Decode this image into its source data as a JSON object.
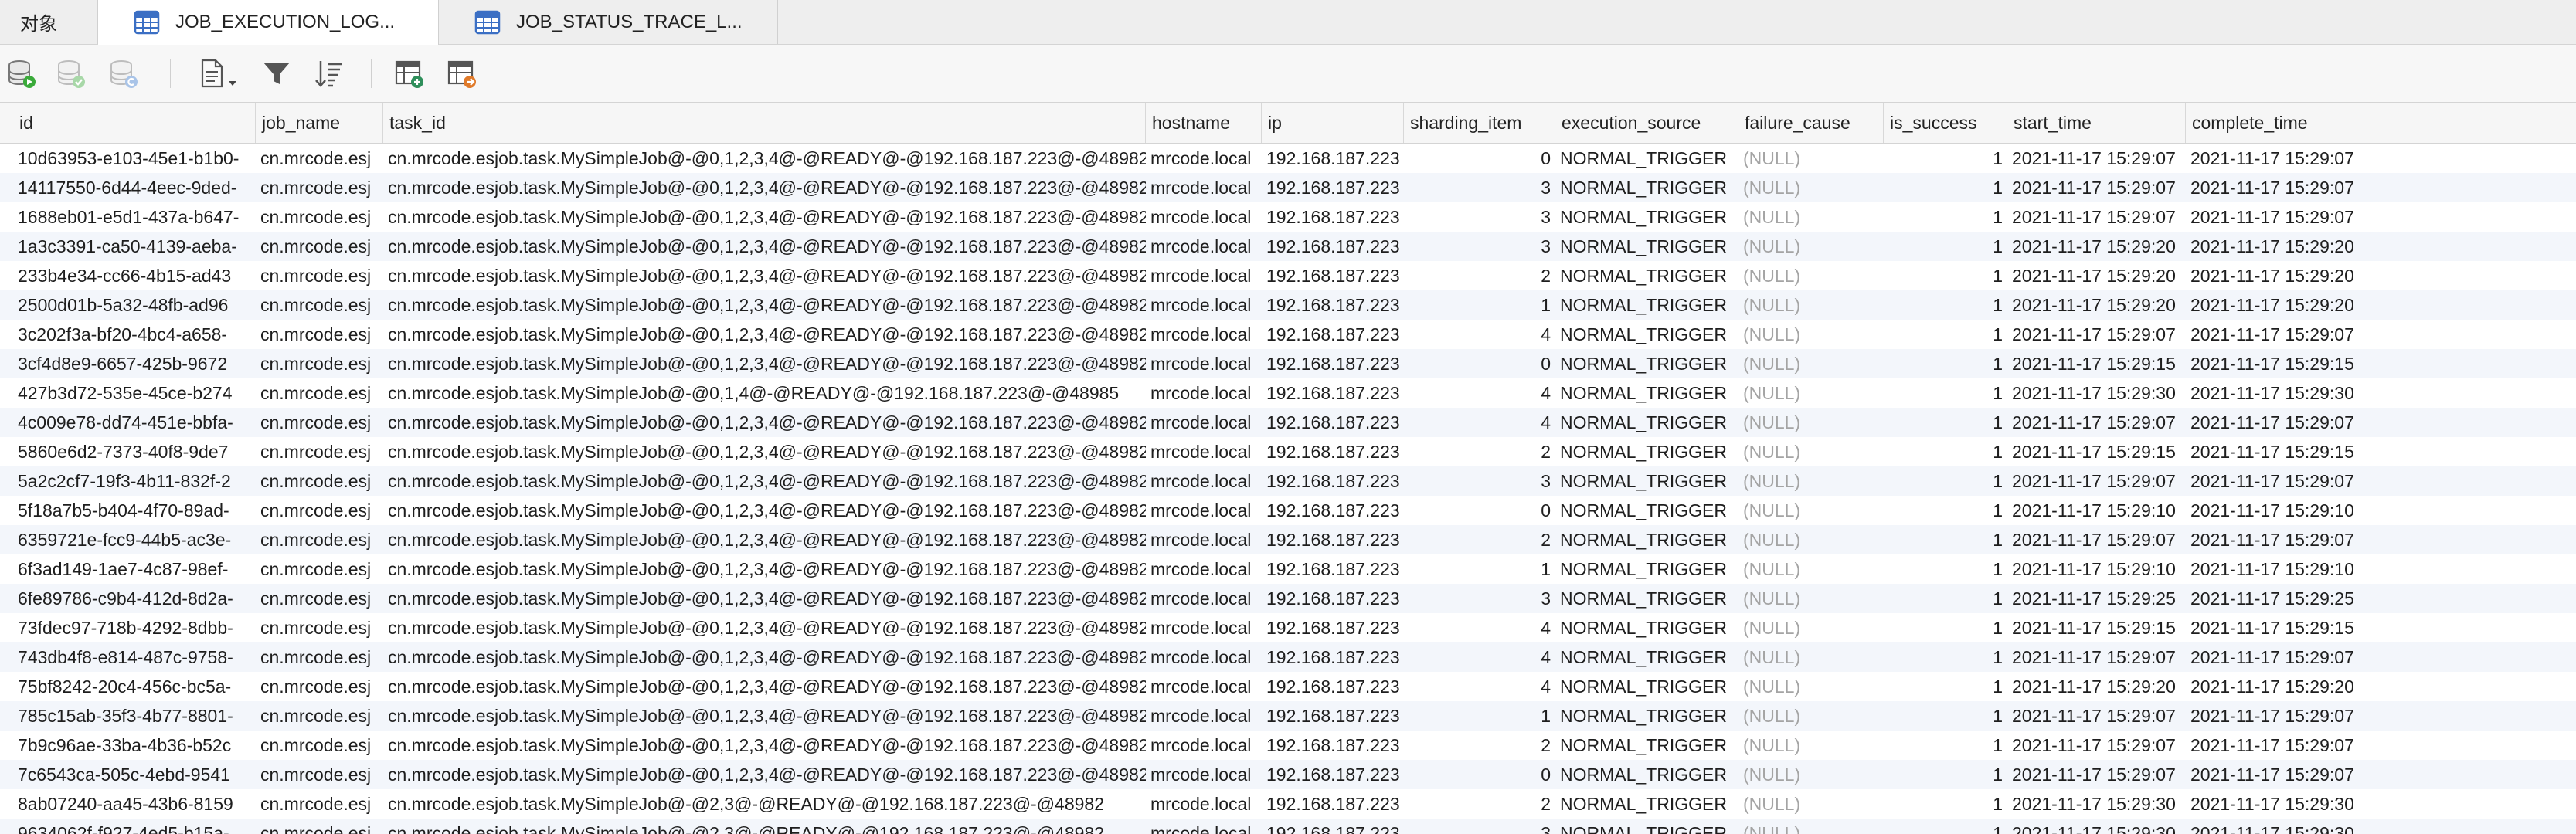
{
  "tabs": {
    "objects": "对象",
    "active": "JOB_EXECUTION_LOG...",
    "second": "JOB_STATUS_TRACE_L..."
  },
  "toolbar": [
    {
      "name": "begin-transaction-icon"
    },
    {
      "name": "commit-icon"
    },
    {
      "name": "rollback-icon"
    },
    {
      "name": "text-view-icon"
    },
    {
      "name": "filter-icon"
    },
    {
      "name": "sort-icon"
    },
    {
      "name": "import-icon"
    },
    {
      "name": "export-icon"
    }
  ],
  "columns": [
    "id",
    "job_name",
    "task_id",
    "hostname",
    "ip",
    "sharding_item",
    "execution_source",
    "failure_cause",
    "is_success",
    "start_time",
    "complete_time"
  ],
  "rows": [
    [
      "10d63953-e103-45e1-b1b0-",
      "cn.mrcode.esj",
      "cn.mrcode.esjob.task.MySimpleJob@-@0,1,2,3,4@-@READY@-@192.168.187.223@-@48982",
      "mrcode.local",
      "192.168.187.223",
      "0",
      "NORMAL_TRIGGER",
      "(NULL)",
      "1",
      "2021-11-17 15:29:07",
      "2021-11-17 15:29:07"
    ],
    [
      "14117550-6d44-4eec-9ded-",
      "cn.mrcode.esj",
      "cn.mrcode.esjob.task.MySimpleJob@-@0,1,2,3,4@-@READY@-@192.168.187.223@-@48982",
      "mrcode.local",
      "192.168.187.223",
      "3",
      "NORMAL_TRIGGER",
      "(NULL)",
      "1",
      "2021-11-17 15:29:07",
      "2021-11-17 15:29:07"
    ],
    [
      "1688eb01-e5d1-437a-b647-",
      "cn.mrcode.esj",
      "cn.mrcode.esjob.task.MySimpleJob@-@0,1,2,3,4@-@READY@-@192.168.187.223@-@48982",
      "mrcode.local",
      "192.168.187.223",
      "3",
      "NORMAL_TRIGGER",
      "(NULL)",
      "1",
      "2021-11-17 15:29:07",
      "2021-11-17 15:29:07"
    ],
    [
      "1a3c3391-ca50-4139-aeba-",
      "cn.mrcode.esj",
      "cn.mrcode.esjob.task.MySimpleJob@-@0,1,2,3,4@-@READY@-@192.168.187.223@-@48982",
      "mrcode.local",
      "192.168.187.223",
      "3",
      "NORMAL_TRIGGER",
      "(NULL)",
      "1",
      "2021-11-17 15:29:20",
      "2021-11-17 15:29:20"
    ],
    [
      "233b4e34-cc66-4b15-ad43",
      "cn.mrcode.esj",
      "cn.mrcode.esjob.task.MySimpleJob@-@0,1,2,3,4@-@READY@-@192.168.187.223@-@48982",
      "mrcode.local",
      "192.168.187.223",
      "2",
      "NORMAL_TRIGGER",
      "(NULL)",
      "1",
      "2021-11-17 15:29:20",
      "2021-11-17 15:29:20"
    ],
    [
      "2500d01b-5a32-48fb-ad96",
      "cn.mrcode.esj",
      "cn.mrcode.esjob.task.MySimpleJob@-@0,1,2,3,4@-@READY@-@192.168.187.223@-@48982",
      "mrcode.local",
      "192.168.187.223",
      "1",
      "NORMAL_TRIGGER",
      "(NULL)",
      "1",
      "2021-11-17 15:29:20",
      "2021-11-17 15:29:20"
    ],
    [
      "3c202f3a-bf20-4bc4-a658-",
      "cn.mrcode.esj",
      "cn.mrcode.esjob.task.MySimpleJob@-@0,1,2,3,4@-@READY@-@192.168.187.223@-@48982",
      "mrcode.local",
      "192.168.187.223",
      "4",
      "NORMAL_TRIGGER",
      "(NULL)",
      "1",
      "2021-11-17 15:29:07",
      "2021-11-17 15:29:07"
    ],
    [
      "3cf4d8e9-6657-425b-9672",
      "cn.mrcode.esj",
      "cn.mrcode.esjob.task.MySimpleJob@-@0,1,2,3,4@-@READY@-@192.168.187.223@-@48982",
      "mrcode.local",
      "192.168.187.223",
      "0",
      "NORMAL_TRIGGER",
      "(NULL)",
      "1",
      "2021-11-17 15:29:15",
      "2021-11-17 15:29:15"
    ],
    [
      "427b3d72-535e-45ce-b274",
      "cn.mrcode.esj",
      "cn.mrcode.esjob.task.MySimpleJob@-@0,1,4@-@READY@-@192.168.187.223@-@48985",
      "mrcode.local",
      "192.168.187.223",
      "4",
      "NORMAL_TRIGGER",
      "(NULL)",
      "1",
      "2021-11-17 15:29:30",
      "2021-11-17 15:29:30"
    ],
    [
      "4c009e78-dd74-451e-bbfa-",
      "cn.mrcode.esj",
      "cn.mrcode.esjob.task.MySimpleJob@-@0,1,2,3,4@-@READY@-@192.168.187.223@-@48982",
      "mrcode.local",
      "192.168.187.223",
      "4",
      "NORMAL_TRIGGER",
      "(NULL)",
      "1",
      "2021-11-17 15:29:07",
      "2021-11-17 15:29:07"
    ],
    [
      "5860e6d2-7373-40f8-9de7",
      "cn.mrcode.esj",
      "cn.mrcode.esjob.task.MySimpleJob@-@0,1,2,3,4@-@READY@-@192.168.187.223@-@48982",
      "mrcode.local",
      "192.168.187.223",
      "2",
      "NORMAL_TRIGGER",
      "(NULL)",
      "1",
      "2021-11-17 15:29:15",
      "2021-11-17 15:29:15"
    ],
    [
      "5a2c2cf7-19f3-4b11-832f-2",
      "cn.mrcode.esj",
      "cn.mrcode.esjob.task.MySimpleJob@-@0,1,2,3,4@-@READY@-@192.168.187.223@-@48982",
      "mrcode.local",
      "192.168.187.223",
      "3",
      "NORMAL_TRIGGER",
      "(NULL)",
      "1",
      "2021-11-17 15:29:07",
      "2021-11-17 15:29:07"
    ],
    [
      "5f18a7b5-b404-4f70-89ad-",
      "cn.mrcode.esj",
      "cn.mrcode.esjob.task.MySimpleJob@-@0,1,2,3,4@-@READY@-@192.168.187.223@-@48982",
      "mrcode.local",
      "192.168.187.223",
      "0",
      "NORMAL_TRIGGER",
      "(NULL)",
      "1",
      "2021-11-17 15:29:10",
      "2021-11-17 15:29:10"
    ],
    [
      "6359721e-fcc9-44b5-ac3e-",
      "cn.mrcode.esj",
      "cn.mrcode.esjob.task.MySimpleJob@-@0,1,2,3,4@-@READY@-@192.168.187.223@-@48982",
      "mrcode.local",
      "192.168.187.223",
      "2",
      "NORMAL_TRIGGER",
      "(NULL)",
      "1",
      "2021-11-17 15:29:07",
      "2021-11-17 15:29:07"
    ],
    [
      "6f3ad149-1ae7-4c87-98ef-",
      "cn.mrcode.esj",
      "cn.mrcode.esjob.task.MySimpleJob@-@0,1,2,3,4@-@READY@-@192.168.187.223@-@48982",
      "mrcode.local",
      "192.168.187.223",
      "1",
      "NORMAL_TRIGGER",
      "(NULL)",
      "1",
      "2021-11-17 15:29:10",
      "2021-11-17 15:29:10"
    ],
    [
      "6fe89786-c9b4-412d-8d2a-",
      "cn.mrcode.esj",
      "cn.mrcode.esjob.task.MySimpleJob@-@0,1,2,3,4@-@READY@-@192.168.187.223@-@48982",
      "mrcode.local",
      "192.168.187.223",
      "3",
      "NORMAL_TRIGGER",
      "(NULL)",
      "1",
      "2021-11-17 15:29:25",
      "2021-11-17 15:29:25"
    ],
    [
      "73fdec97-718b-4292-8dbb-",
      "cn.mrcode.esj",
      "cn.mrcode.esjob.task.MySimpleJob@-@0,1,2,3,4@-@READY@-@192.168.187.223@-@48982",
      "mrcode.local",
      "192.168.187.223",
      "4",
      "NORMAL_TRIGGER",
      "(NULL)",
      "1",
      "2021-11-17 15:29:15",
      "2021-11-17 15:29:15"
    ],
    [
      "743db4f8-e814-487c-9758-",
      "cn.mrcode.esj",
      "cn.mrcode.esjob.task.MySimpleJob@-@0,1,2,3,4@-@READY@-@192.168.187.223@-@48982",
      "mrcode.local",
      "192.168.187.223",
      "4",
      "NORMAL_TRIGGER",
      "(NULL)",
      "1",
      "2021-11-17 15:29:07",
      "2021-11-17 15:29:07"
    ],
    [
      "75bf8242-20c4-456c-bc5a-",
      "cn.mrcode.esj",
      "cn.mrcode.esjob.task.MySimpleJob@-@0,1,2,3,4@-@READY@-@192.168.187.223@-@48982",
      "mrcode.local",
      "192.168.187.223",
      "4",
      "NORMAL_TRIGGER",
      "(NULL)",
      "1",
      "2021-11-17 15:29:20",
      "2021-11-17 15:29:20"
    ],
    [
      "785c15ab-35f3-4b77-8801-",
      "cn.mrcode.esj",
      "cn.mrcode.esjob.task.MySimpleJob@-@0,1,2,3,4@-@READY@-@192.168.187.223@-@48982",
      "mrcode.local",
      "192.168.187.223",
      "1",
      "NORMAL_TRIGGER",
      "(NULL)",
      "1",
      "2021-11-17 15:29:07",
      "2021-11-17 15:29:07"
    ],
    [
      "7b9c96ae-33ba-4b36-b52c",
      "cn.mrcode.esj",
      "cn.mrcode.esjob.task.MySimpleJob@-@0,1,2,3,4@-@READY@-@192.168.187.223@-@48982",
      "mrcode.local",
      "192.168.187.223",
      "2",
      "NORMAL_TRIGGER",
      "(NULL)",
      "1",
      "2021-11-17 15:29:07",
      "2021-11-17 15:29:07"
    ],
    [
      "7c6543ca-505c-4ebd-9541",
      "cn.mrcode.esj",
      "cn.mrcode.esjob.task.MySimpleJob@-@0,1,2,3,4@-@READY@-@192.168.187.223@-@48982",
      "mrcode.local",
      "192.168.187.223",
      "0",
      "NORMAL_TRIGGER",
      "(NULL)",
      "1",
      "2021-11-17 15:29:07",
      "2021-11-17 15:29:07"
    ],
    [
      "8ab07240-aa45-43b6-8159",
      "cn.mrcode.esj",
      "cn.mrcode.esjob.task.MySimpleJob@-@2,3@-@READY@-@192.168.187.223@-@48982",
      "mrcode.local",
      "192.168.187.223",
      "2",
      "NORMAL_TRIGGER",
      "(NULL)",
      "1",
      "2021-11-17 15:29:30",
      "2021-11-17 15:29:30"
    ],
    [
      "9634062f-f927-4ed5-b15a-",
      "cn.mrcode.esj",
      "cn.mrcode.esjob.task.MySimpleJob@-@2,3@-@READY@-@192.168.187.223@-@48982",
      "mrcode.local",
      "192.168.187.223",
      "3",
      "NORMAL_TRIGGER",
      "(NULL)",
      "1",
      "2021-11-17 15:29:30",
      "2021-11-17 15:29:30"
    ]
  ]
}
